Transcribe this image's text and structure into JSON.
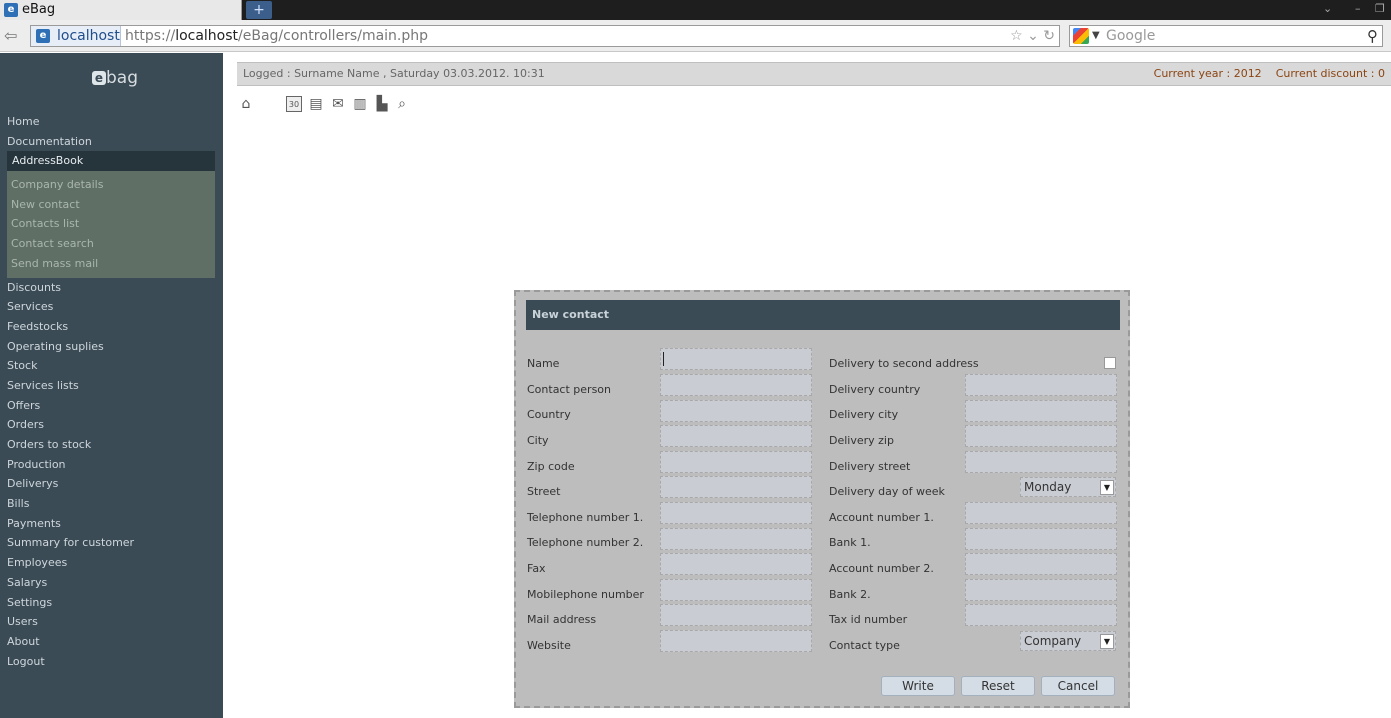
{
  "browser": {
    "tab_title": "eBag",
    "favicon_letter": "e",
    "new_tab": "+",
    "identity": "localhost",
    "url_prefix": "https://",
    "url_host": "localhost",
    "url_path": "/eBag/controllers/main.php",
    "search_placeholder": "Google"
  },
  "sidebar": {
    "logo_letter": "e",
    "logo_text": "bag",
    "items_top": [
      "Home",
      "Documentation"
    ],
    "active_item": "AddressBook",
    "subitems": [
      "Company details",
      "New contact",
      "Contacts list",
      "Contact search",
      "Send mass mail"
    ],
    "items_bottom": [
      "Discounts",
      "Services",
      "Feedstocks",
      "Operating suplies",
      "Stock",
      "Services lists",
      "Offers",
      "Orders",
      "Orders to stock",
      "Production",
      "Deliverys",
      "Bills",
      "Payments",
      "Summary for customer",
      "Employees",
      "Salarys",
      "Settings",
      "Users",
      "About",
      "Logout"
    ]
  },
  "infobar": {
    "logged": "Logged : Surname Name , Saturday 03.03.2012. 10:31",
    "current_year": "Current year : 2012",
    "current_discount": "Current discount : 0"
  },
  "toolbar": {
    "icons": [
      "home-icon",
      "calendar-icon",
      "document-icon",
      "mail-icon",
      "list-icon",
      "book-icon",
      "house-search-icon"
    ],
    "calendar_day": "30"
  },
  "dialog": {
    "title": "New contact",
    "left_labels": [
      "Name",
      "Contact person",
      "Country",
      "City",
      "Zip code",
      "Street",
      "Telephone number 1.",
      "Telephone number 2.",
      "Fax",
      "Mobilephone number",
      "Mail address",
      "Website"
    ],
    "right_labels": [
      "Delivery to second address",
      "Delivery country",
      "Delivery city",
      "Delivery zip",
      "Delivery street",
      "Delivery day of week",
      "Account number 1.",
      "Bank 1.",
      "Account number 2.",
      "Bank 2.",
      "Tax id number",
      "Contact type"
    ],
    "delivery_day_value": "Monday",
    "contact_type_value": "Company",
    "buttons": {
      "write": "Write",
      "reset": "Reset",
      "cancel": "Cancel"
    }
  }
}
